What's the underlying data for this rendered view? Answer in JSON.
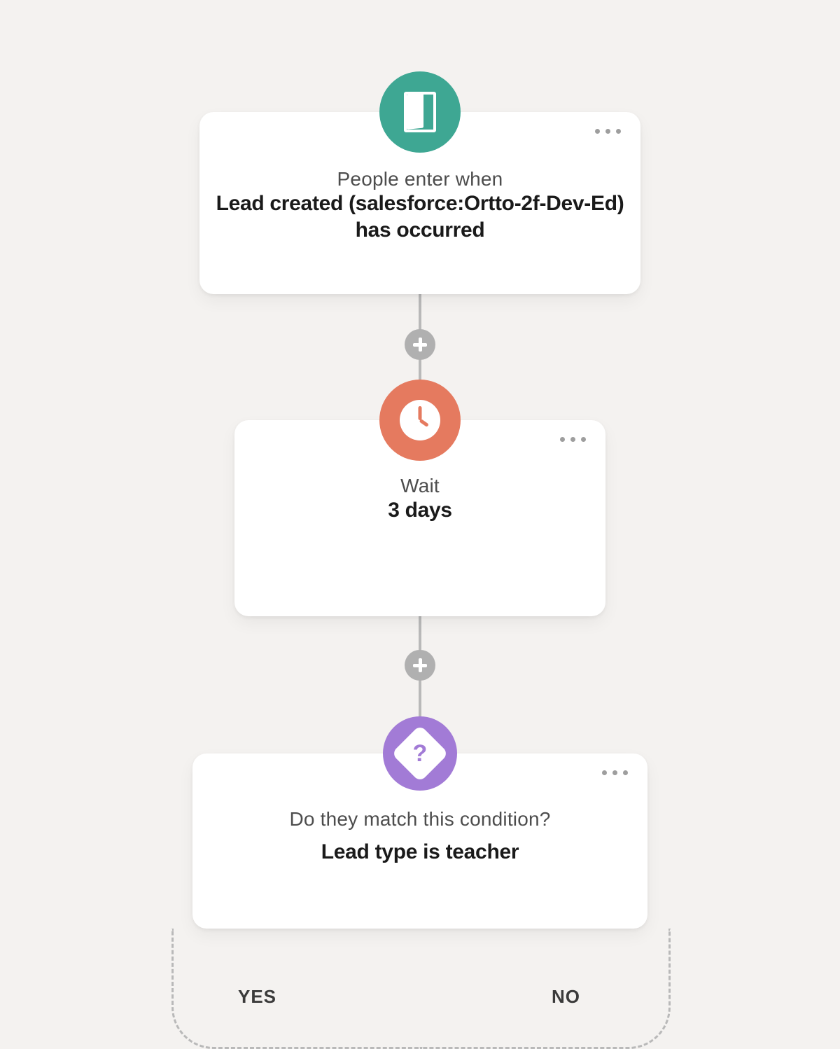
{
  "nodes": {
    "entry": {
      "prompt": "People enter when",
      "bold": "Lead created (salesforce:Ortto-2f-Dev-Ed) has occurred",
      "icon": "door-icon",
      "color": "#3ea793"
    },
    "wait": {
      "prompt": "Wait",
      "bold": "3 days",
      "icon": "clock-icon",
      "color": "#e57a5f"
    },
    "condition": {
      "prompt": "Do they match this condition?",
      "bold": "Lead type is teacher",
      "icon": "question-diamond-icon",
      "color": "#a27bd6"
    }
  },
  "branches": {
    "yes_label": "YES",
    "no_label": "NO"
  }
}
